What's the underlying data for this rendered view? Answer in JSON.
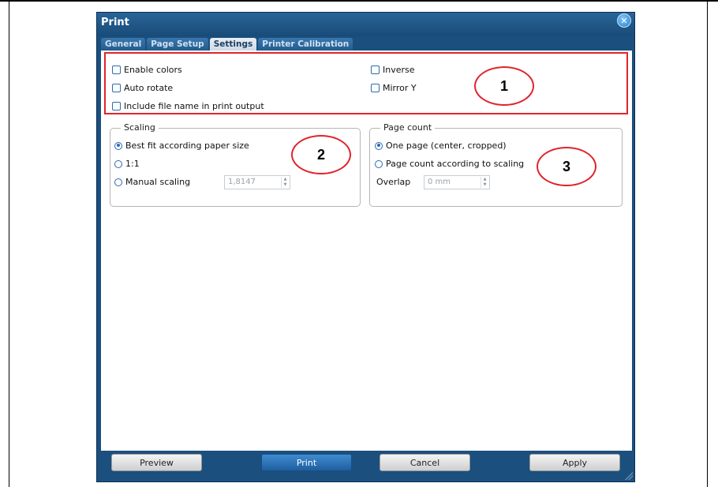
{
  "window": {
    "title": "Print"
  },
  "tabs": [
    "General",
    "Page Setup",
    "Settings",
    "Printer Calibration"
  ],
  "active_tab": "Settings",
  "options": {
    "enable_colors": "Enable colors",
    "auto_rotate": "Auto rotate",
    "include_file_name": "Include file name in print output",
    "inverse": "Inverse",
    "mirror_y": "Mirror Y"
  },
  "scaling": {
    "label": "Scaling",
    "best_fit": "Best fit according paper size",
    "one_to_one": "1:1",
    "manual": "Manual scaling",
    "manual_value": "1,8147",
    "selected": "best_fit"
  },
  "page_count": {
    "label": "Page count",
    "one_page": "One page (center, cropped)",
    "according_scaling": "Page count according to scaling",
    "overlap_label": "Overlap",
    "overlap_value": "0 mm",
    "selected": "one_page"
  },
  "callouts": [
    "1",
    "2",
    "3"
  ],
  "buttons": {
    "preview": "Preview",
    "print": "Print",
    "cancel": "Cancel",
    "apply": "Apply"
  },
  "colors": {
    "title_bar": "#1b4f7e",
    "accent": "#2b6bb0",
    "highlight": "#e0242c"
  }
}
